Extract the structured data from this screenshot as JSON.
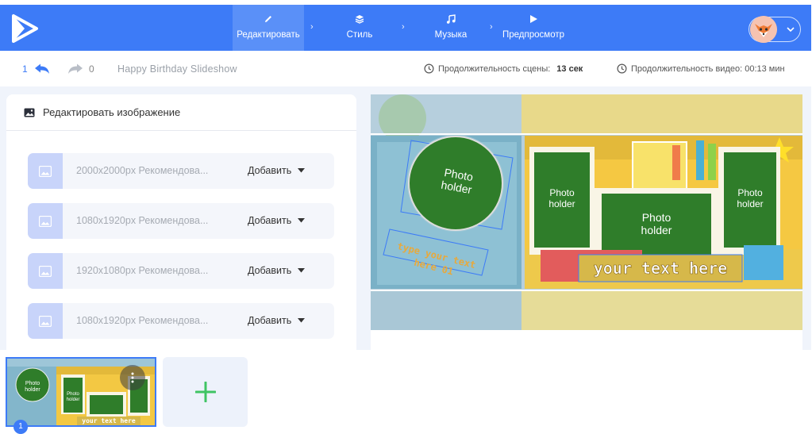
{
  "nav": {
    "steps": [
      {
        "label": "Редактировать",
        "icon": "pencil-icon"
      },
      {
        "label": "Стиль",
        "icon": "layers-icon"
      },
      {
        "label": "Музыка",
        "icon": "music-note-icon"
      },
      {
        "label": "Предпросмотр",
        "icon": "play-icon"
      }
    ],
    "active_step": "Редактировать"
  },
  "toolbar": {
    "undo_count": "1",
    "redo_count": "0",
    "project_title": "Happy Birthday Slideshow",
    "scene_duration_label": "Продолжительность сцены:",
    "scene_duration_value": "13 сек",
    "video_duration_label": "Продолжительность видео: 00:13 мин"
  },
  "panel": {
    "title": "Редактировать изображение",
    "slots": [
      {
        "text": "2000x2000px Рекомендова...",
        "action": "Добавить"
      },
      {
        "text": "1080x1920px Рекомендова...",
        "action": "Добавить"
      },
      {
        "text": "1920x1080px Рекомендова...",
        "action": "Добавить"
      },
      {
        "text": "1080x1920px Рекомендова...",
        "action": "Добавить"
      }
    ]
  },
  "preview": {
    "photo_holder_label": "Photo holder",
    "left_caption": "type your text here 01",
    "banner_text": "your text here"
  },
  "timeline": {
    "scene_number": "1",
    "thumb_photo_label": "Photo holder",
    "thumb_banner": "your text here",
    "add_icon": "plus-icon"
  },
  "colors": {
    "brand_blue": "#3d7bf7",
    "photo_green": "#2f7d2a",
    "add_green": "#3fc463"
  }
}
